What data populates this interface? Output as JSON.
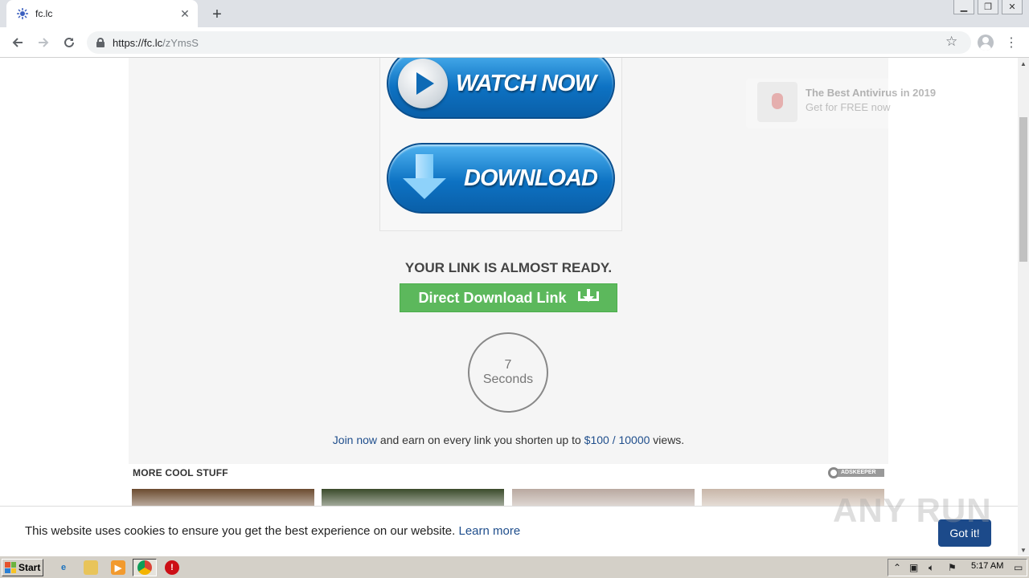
{
  "browser": {
    "tab_title": "fc.lc",
    "tab_close": "✕",
    "new_tab": "+",
    "url_host": "https://fc.lc",
    "url_path": "/zYmsS"
  },
  "page": {
    "watch_label": "WATCH NOW",
    "download_label": "DOWNLOAD",
    "ready_text": "YOUR LINK IS ALMOST READY.",
    "direct_download_label": "Direct Download Link",
    "timer_value": "7",
    "timer_unit": "Seconds",
    "join_link": "Join now",
    "join_mid": " and earn on every link you shorten up to ",
    "join_rate": "$100 / 10000",
    "join_end": " views.",
    "more_title": "MORE COOL STUFF",
    "adskeeper": "ADSKEEPER",
    "thumb_colors": [
      "#6b4a2e",
      "#3a4a2a",
      "#b9a9a0",
      "#c8b6a8"
    ]
  },
  "notification": {
    "title": "The Best Antivirus in 2019",
    "subtitle": "Get for FREE now"
  },
  "cookie": {
    "text": "This website uses cookies to ensure you get the best experience on our website. ",
    "learn_more": "Learn more",
    "button": "Got it!"
  },
  "watermark": "ANY RUN",
  "taskbar": {
    "start": "Start",
    "clock": "5:17 AM"
  },
  "colors": {
    "green_button": "#5cb85c",
    "link_blue": "#1f4e8c",
    "got_it": "#1c4a8a"
  }
}
